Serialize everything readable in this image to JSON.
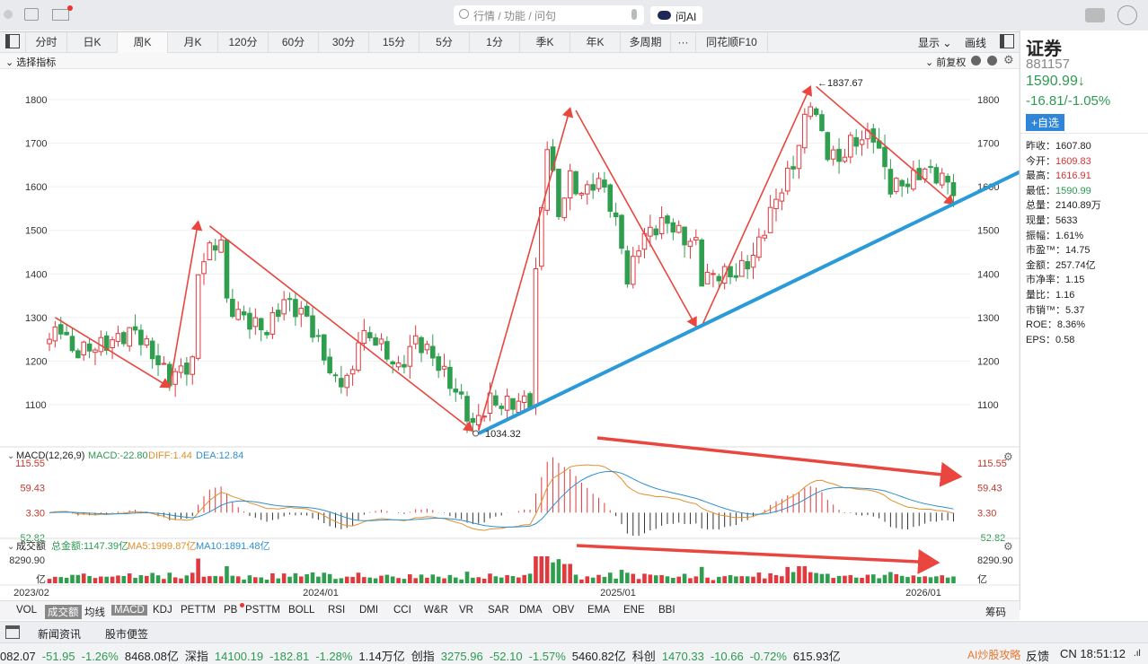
{
  "toolbar": {
    "search_placeholder": "行情 / 功能 / 问句",
    "ask_ai": "问AI"
  },
  "tabs": [
    "分时",
    "日K",
    "周K",
    "月K",
    "120分",
    "60分",
    "30分",
    "15分",
    "5分",
    "1分",
    "季K",
    "年K",
    "多周期",
    "···",
    "同花顺F10"
  ],
  "active_tab": "周K",
  "right_tools": {
    "display": "显示",
    "draw": "画线"
  },
  "sub": {
    "select_indicator": "选择指标",
    "adjust": "前复权"
  },
  "price_axis": [
    "1800",
    "1700",
    "1600",
    "1500",
    "1400",
    "1300",
    "1200",
    "1100"
  ],
  "annotations": {
    "high": "←1837.67",
    "low": "1034.32"
  },
  "macd": {
    "title": "MACD(12,26,9)",
    "macd": "MACD:-22.80",
    "diff": "DIFF:1.44",
    "dea": "DEA:12.84",
    "axis": [
      "115.55",
      "59.43",
      "3.30",
      "-52.82"
    ]
  },
  "volume": {
    "title": "成交额",
    "total": "总金额:1147.39亿",
    "ma5": "MA5:1999.87亿",
    "ma10": "MA10:1891.48亿",
    "axis_top": "8290.90",
    "unit": "亿"
  },
  "dates": [
    "2023/02",
    "2024/01",
    "2025/01",
    "2026/01"
  ],
  "indicators": [
    "VOL",
    "成交额",
    "均线",
    "MACD",
    "KDJ",
    "PETTM",
    "PB",
    "PSTTM",
    "BOLL",
    "RSI",
    "DMI",
    "CCI",
    "W&R",
    "VR",
    "SAR",
    "DMA",
    "OBV",
    "EMA",
    "ENE",
    "BBI"
  ],
  "indicators_active": [
    "成交额",
    "MACD"
  ],
  "chips": "筹码",
  "news_tabs": [
    "新闻资讯",
    "股市便签"
  ],
  "stock": {
    "name": "证券",
    "code": "881157",
    "price": "1590.99↓",
    "change": "-16.81/-1.05%",
    "add_watch": "+自选",
    "stats": [
      [
        "昨收：",
        "1607.80",
        ""
      ],
      [
        "今开：",
        "1609.83",
        "r"
      ],
      [
        "最高：",
        "1616.91",
        "r"
      ],
      [
        "最低：",
        "1590.99",
        "g"
      ],
      [
        "总量：",
        "2140.89万",
        ""
      ],
      [
        "现量：",
        "5633",
        ""
      ],
      [
        "振幅：",
        "1.61%",
        ""
      ],
      [
        "市盈™：",
        "14.75",
        ""
      ],
      [
        "金额：",
        "257.74亿",
        ""
      ],
      [
        "市净率：",
        "1.15",
        ""
      ],
      [
        "量比：",
        "1.16",
        ""
      ],
      [
        "市销™：",
        "5.37",
        ""
      ],
      [
        "ROE：",
        "8.36%",
        ""
      ],
      [
        "EPS：",
        "0.58",
        ""
      ]
    ]
  },
  "ticker": [
    [
      "082.07",
      ""
    ],
    [
      "-51.95",
      "g"
    ],
    [
      "-1.26%",
      "g"
    ],
    [
      "8468.08亿",
      ""
    ],
    [
      "深指",
      ""
    ],
    [
      "14100.19",
      "g"
    ],
    [
      "-182.81",
      "g"
    ],
    [
      "-1.28%",
      "g"
    ],
    [
      "1.14万亿",
      ""
    ],
    [
      "创指",
      ""
    ],
    [
      "3275.96",
      "g"
    ],
    [
      "-52.10",
      "g"
    ],
    [
      "-1.57%",
      "g"
    ],
    [
      "5460.82亿",
      ""
    ],
    [
      "科创",
      ""
    ],
    [
      "1470.33",
      "g"
    ],
    [
      "-10.66",
      "g"
    ],
    [
      "-0.72%",
      "g"
    ],
    [
      "615.93亿",
      ""
    ]
  ],
  "status": {
    "ai": "AI炒股攻略",
    "feedback": "反馈",
    "clock": "CN 18:51:12"
  },
  "colors": {
    "up": "#e0393e",
    "down": "#2f9e4f",
    "arrow": "#e8463f",
    "trend": "#2a9ad8"
  },
  "chart_data": {
    "type": "candlestick",
    "title": "证券 881157 周K",
    "x_unit": "week index from 2023/02",
    "ylim": [
      1000,
      1850
    ],
    "close_waypoints": [
      [
        0,
        1250
      ],
      [
        2,
        1280
      ],
      [
        4,
        1220
      ],
      [
        10,
        1240
      ],
      [
        15,
        1270
      ],
      [
        21,
        1160
      ],
      [
        23,
        1180
      ],
      [
        25,
        1195
      ],
      [
        26,
        1400
      ],
      [
        27,
        1440
      ],
      [
        30,
        1480
      ],
      [
        31,
        1330
      ],
      [
        35,
        1290
      ],
      [
        38,
        1270
      ],
      [
        41,
        1340
      ],
      [
        45,
        1300
      ],
      [
        48,
        1210
      ],
      [
        50,
        1150
      ],
      [
        53,
        1170
      ],
      [
        54,
        1260
      ],
      [
        57,
        1250
      ],
      [
        61,
        1180
      ],
      [
        64,
        1250
      ],
      [
        67,
        1210
      ],
      [
        70,
        1150
      ],
      [
        72,
        1110
      ],
      [
        74,
        1050
      ],
      [
        77,
        1110
      ],
      [
        79,
        1100
      ],
      [
        84,
        1110
      ],
      [
        85,
        1400
      ],
      [
        87,
        1700
      ],
      [
        89,
        1540
      ],
      [
        91,
        1620
      ],
      [
        93,
        1580
      ],
      [
        95,
        1610
      ],
      [
        97,
        1600
      ],
      [
        100,
        1470
      ],
      [
        101,
        1380
      ],
      [
        103,
        1470
      ],
      [
        105,
        1500
      ],
      [
        108,
        1520
      ],
      [
        111,
        1480
      ],
      [
        113,
        1470
      ],
      [
        114,
        1390
      ],
      [
        117,
        1400
      ],
      [
        120,
        1400
      ],
      [
        123,
        1440
      ],
      [
        126,
        1540
      ],
      [
        128,
        1600
      ],
      [
        130,
        1650
      ],
      [
        133,
        1800
      ],
      [
        136,
        1680
      ],
      [
        138,
        1660
      ],
      [
        140,
        1700
      ],
      [
        144,
        1720
      ],
      [
        147,
        1600
      ],
      [
        150,
        1610
      ],
      [
        153,
        1640
      ],
      [
        156,
        1620
      ],
      [
        158,
        1595
      ]
    ],
    "high": 1837.67,
    "low": 1034.32,
    "trend_arrows": [
      [
        [
          1,
          1300
        ],
        [
          21,
          1140
        ]
      ],
      [
        [
          21,
          1140
        ],
        [
          26,
          1520
        ]
      ],
      [
        [
          28,
          1510
        ],
        [
          74,
          1040
        ]
      ],
      [
        [
          75,
          1040
        ],
        [
          91,
          1780
        ]
      ],
      [
        [
          92,
          1775
        ],
        [
          113,
          1280
        ]
      ],
      [
        [
          114,
          1280
        ],
        [
          133,
          1830
        ]
      ],
      [
        [
          134,
          1830
        ],
        [
          158,
          1560
        ]
      ]
    ]
  }
}
